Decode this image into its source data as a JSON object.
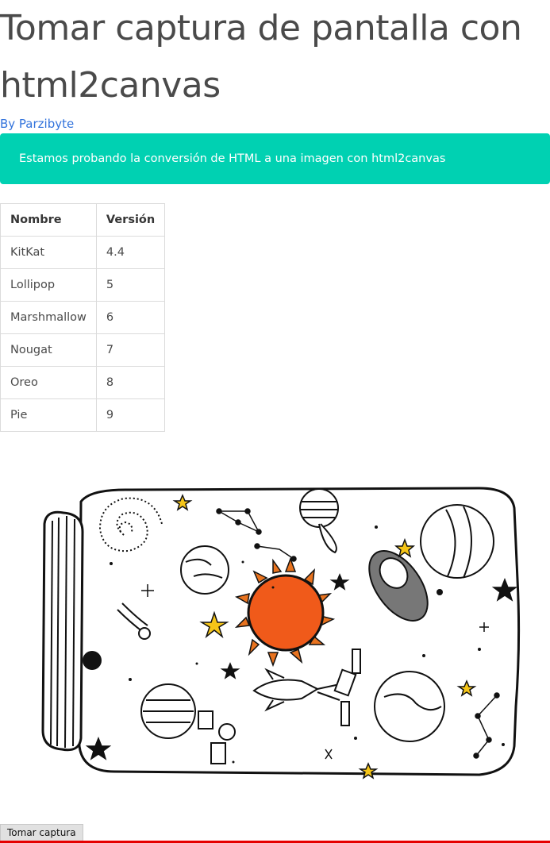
{
  "page": {
    "title": "Tomar captura de pantalla con html2canvas",
    "byline": "By Parzibyte",
    "notice": "Estamos probando la conversión de HTML a una imagen con html2canvas"
  },
  "table": {
    "headers": [
      "Nombre",
      "Versión"
    ],
    "rows": [
      [
        "KitKat",
        "4.4"
      ],
      [
        "Lollipop",
        "5"
      ],
      [
        "Marshmallow",
        "6"
      ],
      [
        "Nougat",
        "7"
      ],
      [
        "Oreo",
        "8"
      ],
      [
        "Pie",
        "9"
      ]
    ]
  },
  "image": {
    "icon": "space-jar-illustration"
  },
  "actions": {
    "capture_label": "Tomar captura"
  },
  "colors": {
    "notice_bg": "#00d1b2",
    "link": "#3273dc",
    "sun": "#f05a1a",
    "sun_rays": "#e8731f",
    "star_yellow": "#f5c518"
  }
}
